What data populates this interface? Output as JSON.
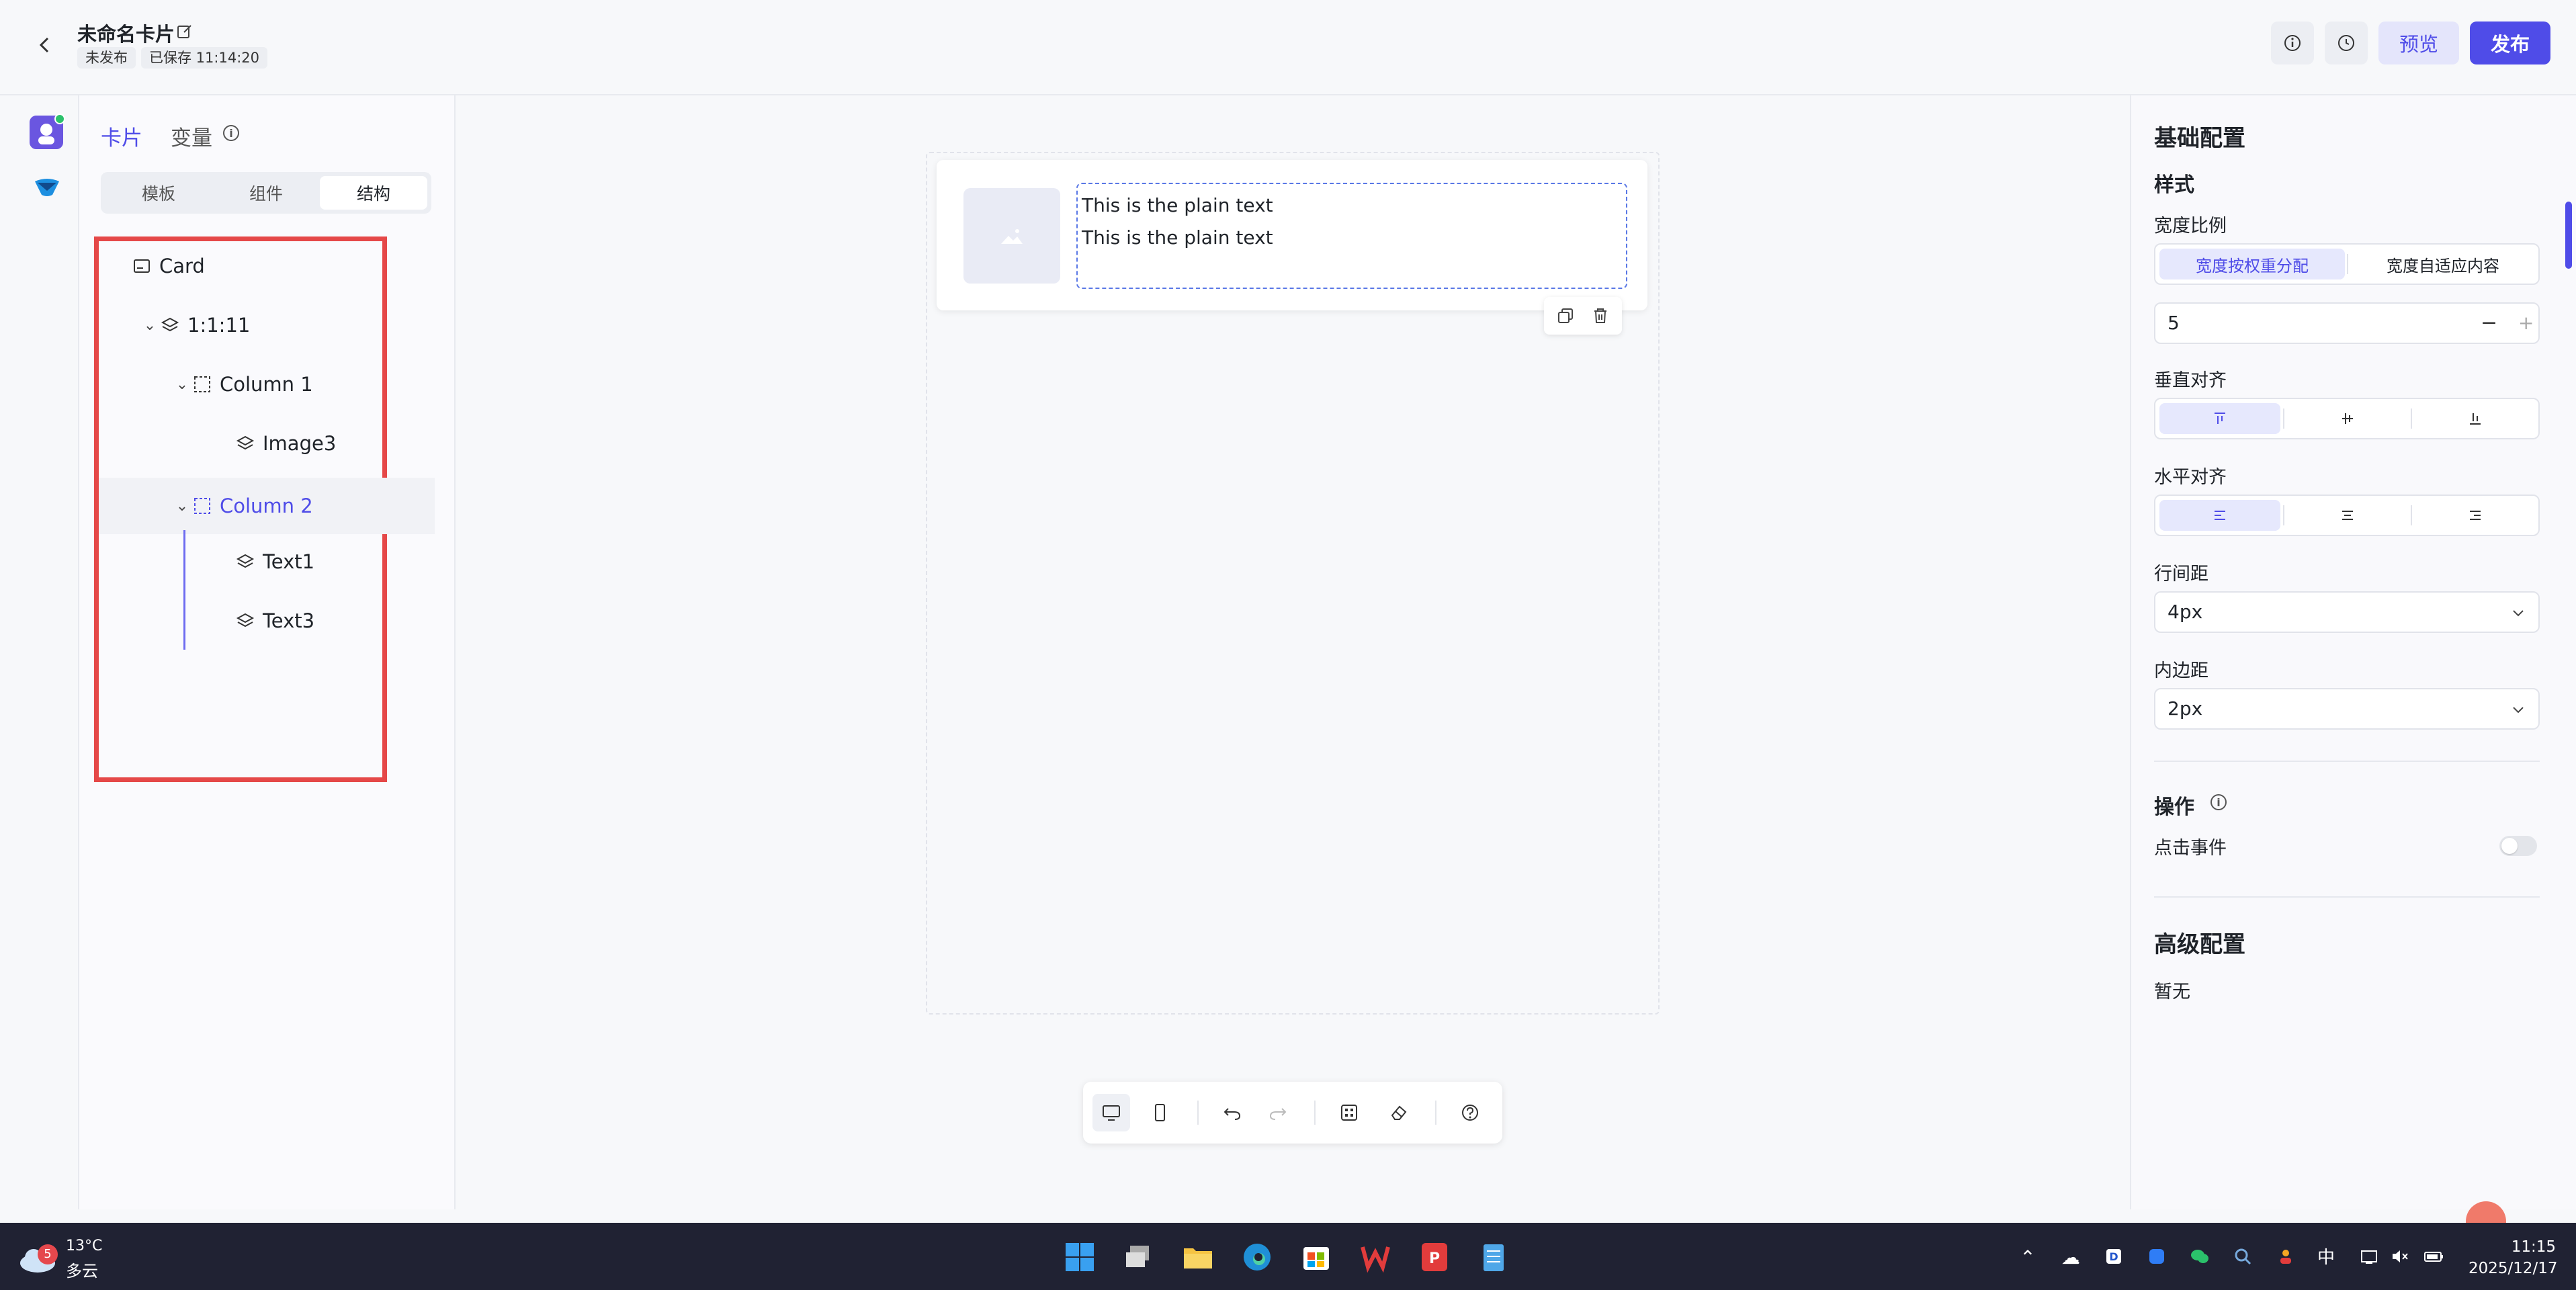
{
  "header": {
    "title": "未命名卡片",
    "status_unpublished": "未发布",
    "saved": "已保存 11:14:20",
    "preview_label": "预览",
    "publish_label": "发布"
  },
  "left_panel": {
    "tabs": [
      {
        "label": "卡片"
      },
      {
        "label": "变量"
      }
    ],
    "segments": [
      {
        "label": "模板"
      },
      {
        "label": "组件"
      },
      {
        "label": "结构"
      }
    ],
    "selected_segment": "结构",
    "tree": [
      {
        "label": "Card"
      },
      {
        "label": "1:1:11"
      },
      {
        "label": "Column 1"
      },
      {
        "label": "Image3"
      },
      {
        "label": "Column 2"
      },
      {
        "label": "Text1"
      },
      {
        "label": "Text3"
      }
    ]
  },
  "canvas": {
    "text_lines": [
      "This is the plain text",
      "This is the plain text"
    ]
  },
  "right_panel": {
    "basic_title": "基础配置",
    "style_title": "样式",
    "width_ratio_label": "宽度比例",
    "width_options": [
      "宽度按权重分配",
      "宽度自适应内容"
    ],
    "weight_value": "5",
    "valign_label": "垂直对齐",
    "halign_label": "水平对齐",
    "line_spacing_label": "行间距",
    "line_spacing_value": "4px",
    "padding_label": "内边距",
    "padding_value": "2px",
    "action_title": "操作",
    "click_event_label": "点击事件",
    "click_event_enabled": false,
    "advanced_title": "高级配置",
    "advanced_value": "暂无"
  },
  "taskbar": {
    "weather_badge": "5",
    "temperature": "13°C",
    "weather": "多云",
    "ime": "中",
    "time": "11:15",
    "date": "2025/12/17"
  },
  "colors": {
    "accent": "#4f4ce8",
    "highlight_border": "#e54848"
  }
}
